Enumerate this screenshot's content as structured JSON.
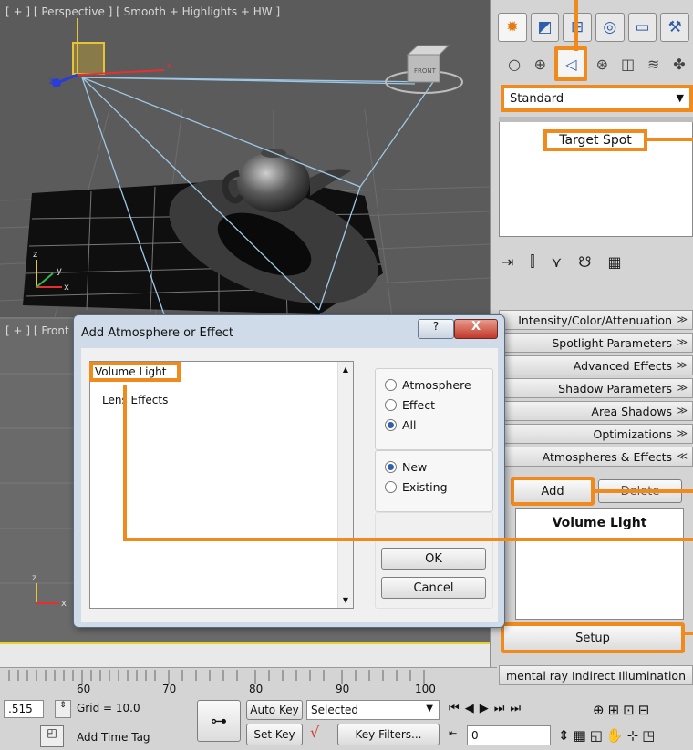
{
  "viewports": {
    "perspective_label": "[ + ] [ Perspective ] [ Smooth + Highlights + HW ]",
    "front_label": "[ + ] [ Front"
  },
  "command_panel": {
    "tabs": [
      "create-icon",
      "modify-icon",
      "hierarchy-icon",
      "motion-icon",
      "display-icon",
      "utilities-icon"
    ],
    "categories": [
      "geometry-icon",
      "shapes-icon",
      "lights-icon",
      "cameras-icon",
      "helpers-icon",
      "spacewarps-icon",
      "systems-icon"
    ],
    "dropdown_value": "Standard",
    "selected_object": "Target Spot",
    "rollouts": [
      "Intensity/Color/Attenuation",
      "Spotlight Parameters",
      "Advanced Effects",
      "Shadow Parameters",
      "Area Shadows",
      "Optimizations",
      "Atmospheres & Effects"
    ],
    "add_label": "Add",
    "delete_label": "Delete",
    "effect_item": "Volume Light",
    "setup_label": "Setup",
    "mr_rollout": "mental ray Indirect Illumination"
  },
  "dialog": {
    "title": "Add  Atmosphere or Effect",
    "help_label": "?",
    "close_label": "X",
    "list_items": [
      "Volume Light",
      "Lens Effects"
    ],
    "filter_options": [
      "Atmosphere",
      "Effect",
      "All"
    ],
    "filter_selected": "All",
    "mode_options": [
      "New",
      "Existing"
    ],
    "mode_selected": "New",
    "ok_label": "OK",
    "cancel_label": "Cancel"
  },
  "timeline": {
    "ticks": [
      "60",
      "70",
      "80",
      "90",
      "100"
    ]
  },
  "status_bar": {
    "coord_value": ".515",
    "grid_label": "Grid = 10.0",
    "add_time_tag": "Add Time Tag",
    "auto_key": "Auto Key",
    "set_key": "Set Key",
    "selected_value": "Selected",
    "key_filters": "Key Filters...",
    "frame_value": "0"
  }
}
